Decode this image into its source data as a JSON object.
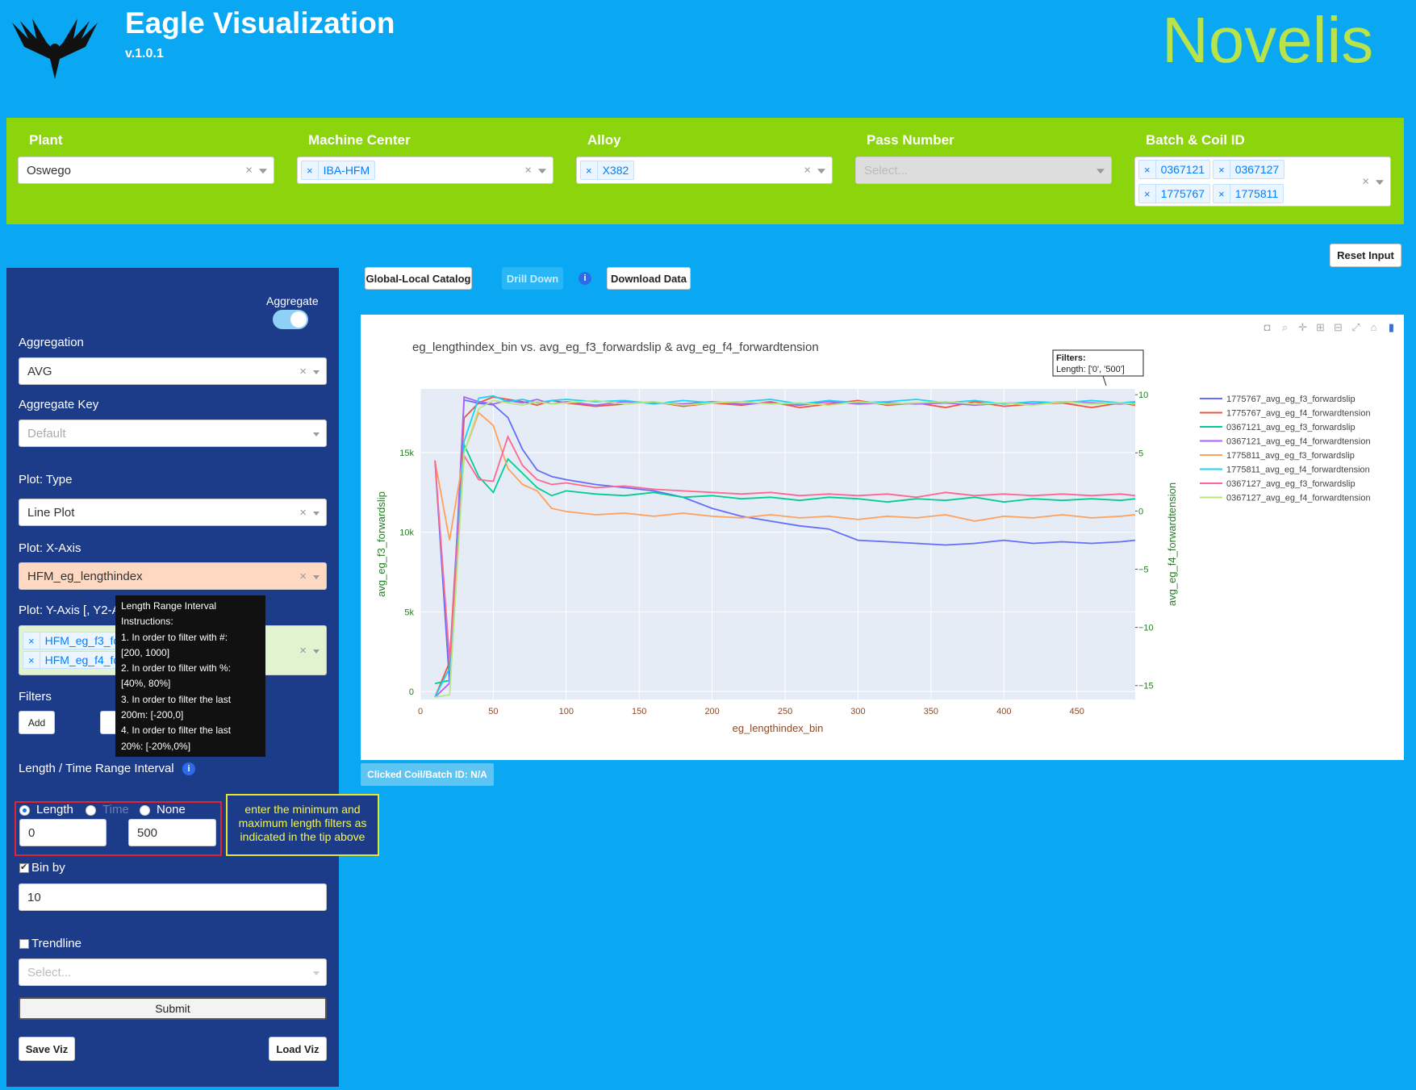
{
  "header": {
    "title": "Eagle Visualization",
    "version": "v.1.0.1",
    "brand": "Novelis"
  },
  "filters": {
    "plant": {
      "label": "Plant",
      "value": "Oswego"
    },
    "machine_center": {
      "label": "Machine Center",
      "tags": [
        "IBA-HFM"
      ]
    },
    "alloy": {
      "label": "Alloy",
      "tags": [
        "X382"
      ]
    },
    "pass_number": {
      "label": "Pass Number",
      "placeholder": "Select..."
    },
    "batch_coil": {
      "label": "Batch & Coil ID",
      "tags": [
        "0367121",
        "0367127",
        "1775767",
        "1775811"
      ]
    }
  },
  "toolbar": {
    "reset": "Reset Input",
    "global_local": "Global-Local Catalog",
    "drill_down": "Drill Down",
    "download": "Download Data",
    "info": "i"
  },
  "panel": {
    "aggregate_label": "Aggregate",
    "aggregation_label": "Aggregation",
    "aggregation_value": "AVG",
    "aggregate_key_label": "Aggregate Key",
    "aggregate_key_placeholder": "Default",
    "plot_type_label": "Plot: Type",
    "plot_type_value": "Line Plot",
    "xaxis_label": "Plot: X-Axis",
    "xaxis_value": "HFM_eg_lengthindex",
    "yaxis_label": "Plot: Y-Axis [, Y2-A",
    "yaxis_tags": [
      "HFM_eg_f3_for",
      "HFM_eg_f4_for"
    ],
    "filters_label": "Filters",
    "add_button": "Add",
    "hidden_button": "R",
    "range_label": "Length / Time Range Interval",
    "radio_length": "Length",
    "radio_time": "Time",
    "radio_none": "None",
    "range_min": "0",
    "range_max": "500",
    "bin_label": "Bin by",
    "bin_value": "10",
    "trendline_label": "Trendline",
    "trendline_placeholder": "Select...",
    "submit": "Submit",
    "save": "Save Viz",
    "load": "Load Viz"
  },
  "tooltip": {
    "lines": [
      "Length Range Interval",
      "Instructions:",
      "1. In order to filter with #:",
      "[200, 1000]",
      "2. In order to filter with %:",
      "[40%, 80%]",
      "3. In order to filter the last",
      "200m: [-200,0]",
      "4. In order to filter the last",
      "20%: [-20%,0%]"
    ]
  },
  "note": "enter the minimum and maximum length filters as indicated in the tip above",
  "clicked": "Clicked Coil/Batch ID: N/A",
  "chart_data": {
    "type": "line",
    "title": "eg_lengthindex_bin vs. avg_eg_f3_forwardslip & avg_eg_f4_forwardtension",
    "xlabel": "eg_lengthindex_bin",
    "ylabel": "avg_eg_f3_forwardslip",
    "y2label": "avg_eg_f4_forwardtension",
    "xlim": [
      0,
      490
    ],
    "ylim": [
      -500,
      19000
    ],
    "y2lim": [
      -16.2,
      10.5
    ],
    "xticks": [
      0,
      50,
      100,
      150,
      200,
      250,
      300,
      350,
      400,
      450
    ],
    "yticks": [
      {
        "v": 0,
        "t": "0"
      },
      {
        "v": 5000,
        "t": "5k"
      },
      {
        "v": 10000,
        "t": "10k"
      },
      {
        "v": 15000,
        "t": "15k"
      }
    ],
    "y2ticks": [
      10,
      5,
      0,
      -5,
      -10,
      -15
    ],
    "annotation": {
      "title": "Filters:",
      "text": "Length: ['0', '500']"
    },
    "legend_position": "right",
    "x": [
      10,
      20,
      30,
      40,
      50,
      60,
      70,
      80,
      90,
      100,
      120,
      140,
      160,
      180,
      200,
      220,
      240,
      260,
      280,
      300,
      320,
      340,
      360,
      380,
      400,
      420,
      440,
      460,
      480,
      490
    ],
    "series": [
      {
        "name": "1775767_avg_eg_f3_forwardslip",
        "color": "#636efa",
        "axis": "y",
        "values": [
          14500,
          500,
          18300,
          18100,
          18000,
          17200,
          15200,
          13900,
          13500,
          13300,
          13000,
          12800,
          12600,
          12200,
          11500,
          11000,
          10700,
          10400,
          10200,
          9500,
          9400,
          9300,
          9200,
          9300,
          9500,
          9300,
          9400,
          9300,
          9400,
          9500
        ]
      },
      {
        "name": "1775767_avg_eg_f4_forwardtension",
        "color": "#ef553b",
        "axis": "y2",
        "values": [
          -16,
          -13,
          8,
          9.3,
          9.8,
          9.6,
          9.4,
          9.1,
          9.5,
          9.3,
          9.0,
          9.2,
          9.4,
          9.0,
          9.3,
          9.1,
          9.4,
          8.9,
          9.2,
          9.5,
          9.1,
          9.3,
          8.9,
          9.4,
          9.0,
          9.2,
          9.3,
          8.9,
          9.3,
          9.1
        ]
      },
      {
        "name": "0367121_avg_eg_f3_forwardslip",
        "color": "#00cc96",
        "axis": "y",
        "values": [
          500,
          700,
          15500,
          13500,
          12500,
          14600,
          13700,
          12800,
          12300,
          12600,
          12400,
          12300,
          12500,
          12200,
          12300,
          12100,
          12200,
          12000,
          12200,
          12100,
          11900,
          12100,
          12000,
          12200,
          11900,
          12100,
          12000,
          12100,
          12000,
          12100
        ]
      },
      {
        "name": "0367121_avg_eg_f4_forwardtension",
        "color": "#ab63fa",
        "axis": "y2",
        "values": [
          -16,
          -14.8,
          9.8,
          9.4,
          9.2,
          9.5,
          9.3,
          9.6,
          9.2,
          9.4,
          9.1,
          9.4,
          9.3,
          9.2,
          9.4,
          9.2,
          9.3,
          9.1,
          9.4,
          9.2,
          9.3,
          9.2,
          9.3,
          9.1,
          9.3,
          9.2,
          9.4,
          9.3,
          9.2,
          9.3
        ]
      },
      {
        "name": "1775811_avg_eg_f3_forwardslip",
        "color": "#ffa15a",
        "axis": "y",
        "values": [
          14500,
          9500,
          15000,
          17500,
          16700,
          14000,
          13000,
          12600,
          11500,
          11300,
          11100,
          11200,
          11000,
          11200,
          11000,
          10900,
          11100,
          10900,
          11000,
          10800,
          11000,
          10900,
          11100,
          10700,
          11000,
          10900,
          11100,
          10900,
          11000,
          11100
        ]
      },
      {
        "name": "1775811_avg_eg_f4_forwardtension",
        "color": "#19d3f3",
        "axis": "y2",
        "values": [
          -16,
          -13.5,
          6,
          9.7,
          9.9,
          9.4,
          9.6,
          9.3,
          9.5,
          9.6,
          9.4,
          9.5,
          9.2,
          9.5,
          9.3,
          9.4,
          9.6,
          9.2,
          9.5,
          9.3,
          9.4,
          9.6,
          9.3,
          9.5,
          9.2,
          9.4,
          9.3,
          9.5,
          9.3,
          9.4
        ]
      },
      {
        "name": "0367127_avg_eg_f3_forwardslip",
        "color": "#ff6692",
        "axis": "y",
        "values": [
          14500,
          2000,
          14800,
          13300,
          13200,
          16000,
          14200,
          13300,
          13000,
          13100,
          12800,
          12900,
          12700,
          12600,
          12500,
          12400,
          12500,
          12300,
          12400,
          12300,
          12400,
          12200,
          12500,
          12300,
          12400,
          12300,
          12400,
          12300,
          12400,
          12300
        ]
      },
      {
        "name": "0367127_avg_eg_f4_forwardtension",
        "color": "#b6e880",
        "axis": "y2",
        "values": [
          -16,
          -15.8,
          5,
          8.8,
          9.5,
          9.3,
          9.1,
          9.4,
          9.2,
          9.3,
          9.5,
          9.2,
          9.4,
          9.1,
          9.3,
          9.4,
          9.2,
          9.3,
          9.1,
          9.4,
          9.2,
          9.3,
          9.4,
          9.2,
          9.3,
          9.1,
          9.4,
          9.2,
          9.3,
          9.2
        ]
      }
    ]
  }
}
